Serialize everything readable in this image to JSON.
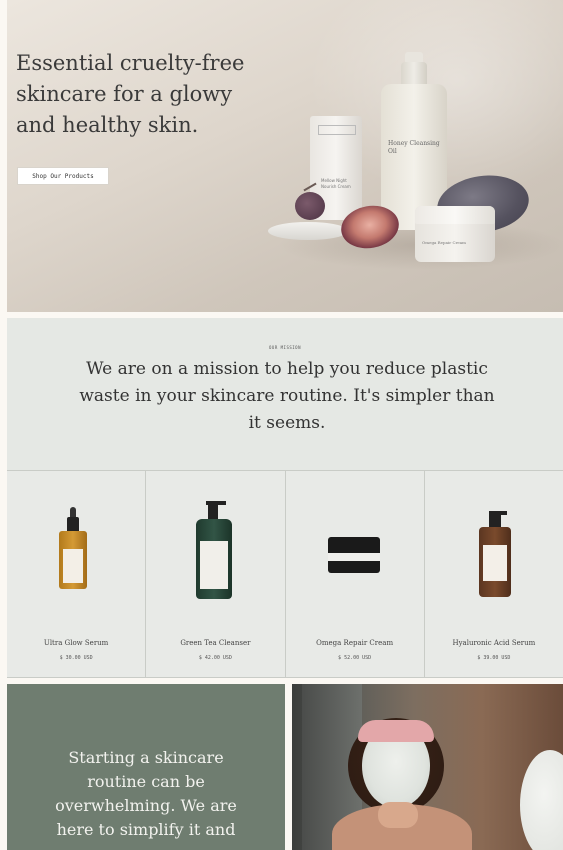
{
  "hero": {
    "title": "Essential cruelty-free skincare for a glowy and healthy skin.",
    "button_label": "Shop Our Products",
    "tube_text": "Mellow Night Nourish Cream",
    "bottle_text": "Honey Cleansing Oil",
    "jar_text": "Omega Repair Cream"
  },
  "mission": {
    "label": "OUR MISSION",
    "text": "We are on a mission to help you reduce plastic waste in your skincare routine. It's simpler than it seems."
  },
  "products": [
    {
      "name": "Ultra Glow Serum",
      "price": "$ 30.00 USD"
    },
    {
      "name": "Green Tea Cleanser",
      "price": "$ 42.00 USD"
    },
    {
      "name": "Omega Repair Cream",
      "price": "$ 52.00 USD"
    },
    {
      "name": "Hyaluronic Acid Serum",
      "price": "$ 39.00 USD"
    }
  ],
  "bottom": {
    "text": "Starting a skincare routine can be overwhelming. We are here to simplify it and"
  },
  "colors": {
    "hero_bg": "#ded6cc",
    "mission_bg": "#e5e8e4",
    "grid_bg": "#e8eae7",
    "bottom_green": "#6f7d70",
    "text_dark": "#333333"
  }
}
